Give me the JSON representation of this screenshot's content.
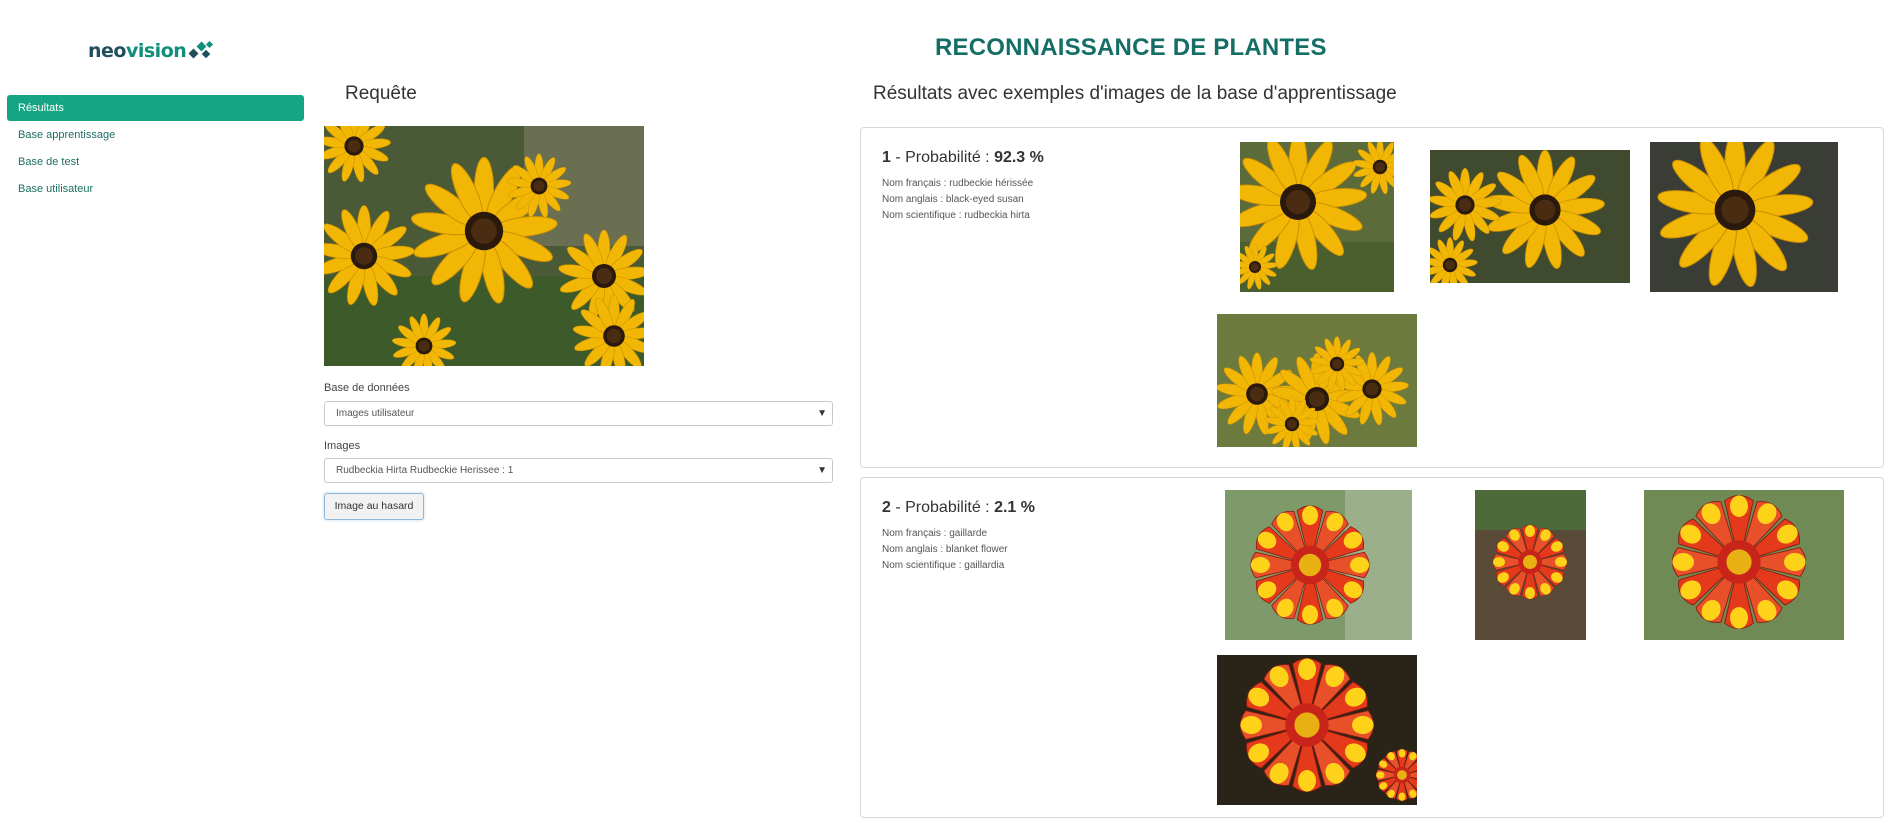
{
  "brand": {
    "part1": "neo",
    "part2": "vision"
  },
  "colors": {
    "accent": "#16a583",
    "title": "#146e66",
    "nav_text": "#1d6f63"
  },
  "sidebar": {
    "items": [
      {
        "label": "Résultats",
        "active": true
      },
      {
        "label": "Base apprentissage",
        "active": false
      },
      {
        "label": "Base de test",
        "active": false
      },
      {
        "label": "Base utilisateur",
        "active": false
      }
    ]
  },
  "page_title": "RECONNAISSANCE DE PLANTES",
  "query": {
    "heading": "Requête",
    "database_label": "Base de données",
    "database_value": "Images utilisateur",
    "images_label": "Images",
    "images_value": "Rudbeckia Hirta Rudbeckie Herissee : 1",
    "random_button": "Image au hasard"
  },
  "results": {
    "heading": "Résultats avec exemples d'images de la base d'apprentissage",
    "items": [
      {
        "rank": "1",
        "prob_label": " - Probabilité : ",
        "prob_value": "92.3 %",
        "french": "Nom français : rudbeckie hérissée",
        "english": "Nom anglais : black-eyed susan",
        "scientific": "Nom scientifique : rudbeckia hirta"
      },
      {
        "rank": "2",
        "prob_label": " - Probabilité : ",
        "prob_value": "2.1 %",
        "french": "Nom français : gaillarde",
        "english": "Nom anglais : blanket flower",
        "scientific": "Nom scientifique : gaillardia"
      }
    ]
  }
}
